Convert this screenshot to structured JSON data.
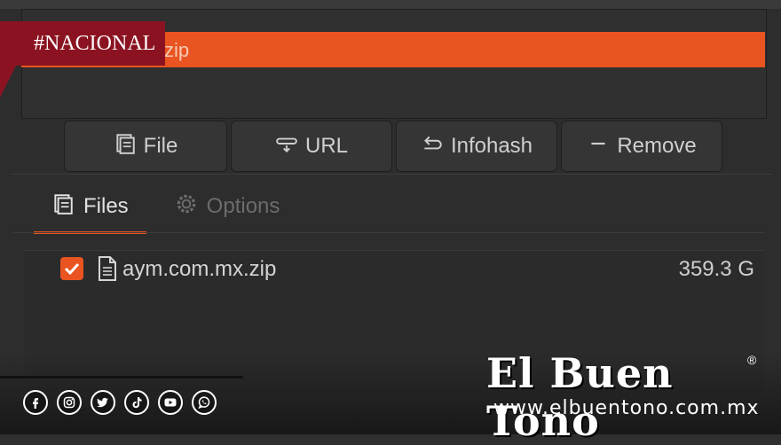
{
  "badge": {
    "label": "#NACIONAL"
  },
  "selected_item": {
    "text": "zip"
  },
  "toolbar": {
    "file_label": "File",
    "url_label": "URL",
    "infohash_label": "Infohash",
    "remove_label": "Remove"
  },
  "tabs": [
    {
      "label": "Files",
      "active": true
    },
    {
      "label": "Options",
      "active": false
    }
  ],
  "files": [
    {
      "name": "aym.com.mx.zip",
      "size": "359.3 G",
      "checked": true
    }
  ],
  "branding": {
    "name": "El Buen Tono",
    "registered": "®",
    "url": "www.elbuentono.com.mx"
  },
  "socials": [
    "facebook-icon",
    "instagram-icon",
    "twitter-icon",
    "tiktok-icon",
    "youtube-icon",
    "whatsapp-icon"
  ],
  "colors": {
    "accent": "#e95420",
    "badge": "#8b1321",
    "background": "#2d2d2d"
  }
}
